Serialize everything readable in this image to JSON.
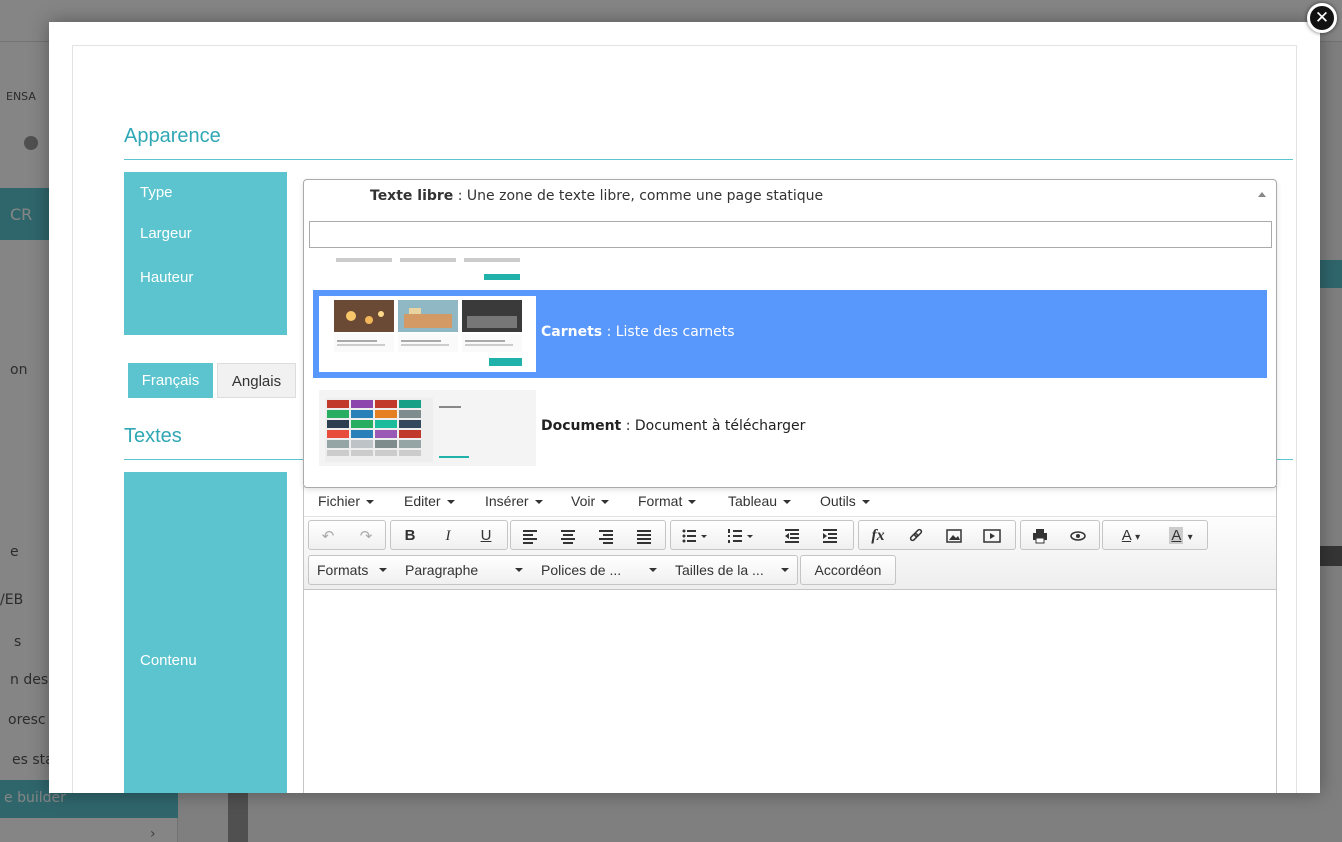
{
  "background": {
    "side_button": "CR",
    "side_items": [
      "on",
      "e",
      "/EB",
      "s",
      "n des r",
      "oresc",
      "es sta"
    ],
    "side_active": "e builder",
    "logo_text": "ENSA"
  },
  "modal": {
    "section_appearance": "Apparence",
    "section_texts": "Textes",
    "labels": {
      "type": "Type",
      "width": "Largeur",
      "height": "Hauteur",
      "content": "Contenu"
    },
    "lang_tabs": [
      "Français",
      "Anglais"
    ]
  },
  "type_select": {
    "selected_name": "Texte libre",
    "selected_desc": " : Une zone de texte libre, comme une page statique",
    "search_value": "",
    "options": [
      {
        "name": "Carnets",
        "desc": " : Liste des carnets",
        "highlighted": true
      },
      {
        "name": "Document",
        "desc": " : Document à télécharger",
        "highlighted": false
      }
    ]
  },
  "editor": {
    "menu": [
      "Fichier",
      "Editer",
      "Insérer",
      "Voir",
      "Format",
      "Tableau",
      "Outils"
    ],
    "formats_dropdown": "Formats",
    "paragraph_dropdown": "Paragraphe",
    "fonts_dropdown": "Polices de ...",
    "sizes_dropdown": "Tailles de la ...",
    "accordion_button": "Accordéon",
    "content": ""
  },
  "colors": {
    "accent": "#5bc4cf",
    "title": "#2fa7b4",
    "highlight": "#5897fb"
  }
}
